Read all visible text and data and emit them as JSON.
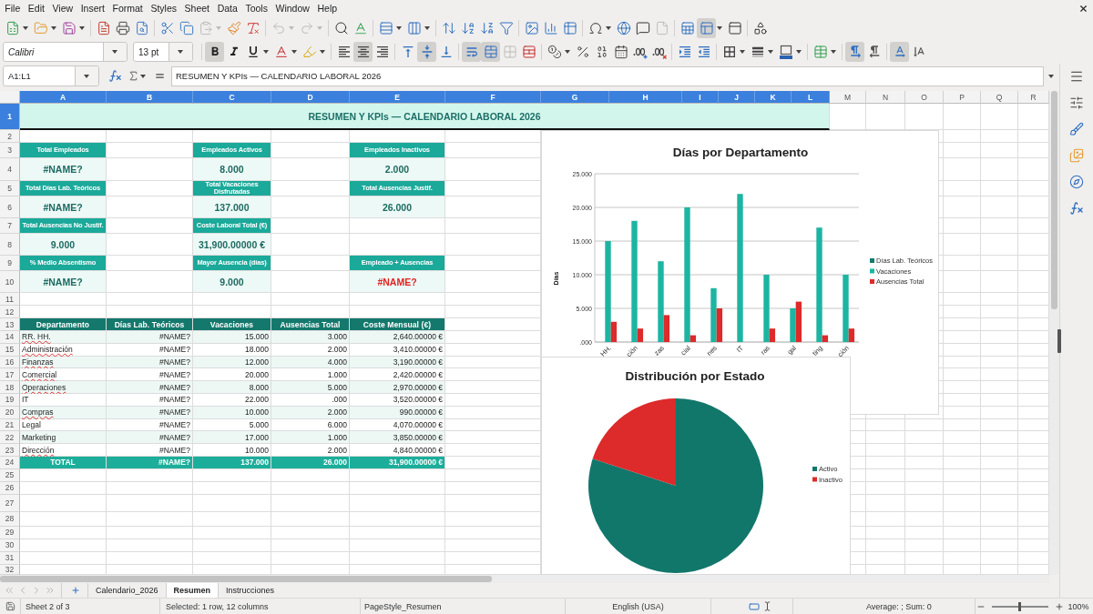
{
  "menu_bar": {
    "items": [
      "File",
      "Edit",
      "View",
      "Insert",
      "Format",
      "Styles",
      "Sheet",
      "Data",
      "Tools",
      "Window",
      "Help"
    ]
  },
  "standard_toolbar": [
    {
      "kind": "new",
      "pressed": false,
      "disabled": false
    },
    {
      "kind": "open",
      "pressed": false,
      "disabled": false
    },
    {
      "kind": "save",
      "pressed": false,
      "disabled": false
    },
    {
      "kind": "export_pdf",
      "pressed": false,
      "disabled": false
    },
    {
      "kind": "print",
      "pressed": false,
      "disabled": false
    },
    {
      "kind": "print_preview",
      "pressed": false,
      "disabled": false
    },
    {
      "kind": "cut",
      "pressed": false,
      "disabled": false
    },
    {
      "kind": "copy",
      "pressed": false,
      "disabled": false
    },
    {
      "kind": "paste",
      "pressed": false,
      "disabled": true
    },
    {
      "kind": "clone",
      "pressed": false,
      "disabled": false
    },
    {
      "kind": "clear",
      "pressed": false,
      "disabled": false
    },
    {
      "kind": "undo",
      "pressed": false,
      "disabled": true
    },
    {
      "kind": "redo",
      "pressed": false,
      "disabled": true
    },
    {
      "kind": "find",
      "pressed": false,
      "disabled": false
    },
    {
      "kind": "spelling",
      "pressed": false,
      "disabled": false
    },
    {
      "kind": "row",
      "pressed": false,
      "disabled": false
    },
    {
      "kind": "column",
      "pressed": false,
      "disabled": false
    },
    {
      "kind": "sort",
      "pressed": false,
      "disabled": false
    },
    {
      "kind": "sort_asc",
      "pressed": false,
      "disabled": false
    },
    {
      "kind": "sort_desc",
      "pressed": false,
      "disabled": false
    },
    {
      "kind": "autofilter",
      "pressed": false,
      "disabled": false
    },
    {
      "kind": "image",
      "pressed": false,
      "disabled": false
    },
    {
      "kind": "chart",
      "pressed": false,
      "disabled": false
    },
    {
      "kind": "pivot",
      "pressed": false,
      "disabled": false
    },
    {
      "kind": "special_char",
      "pressed": false,
      "disabled": false
    },
    {
      "kind": "hyperlink",
      "pressed": false,
      "disabled": false
    },
    {
      "kind": "comment",
      "pressed": false,
      "disabled": false
    },
    {
      "kind": "header_footer",
      "pressed": false,
      "disabled": true
    },
    {
      "kind": "print_area",
      "pressed": false,
      "disabled": false
    },
    {
      "kind": "freeze",
      "pressed": true,
      "disabled": false
    },
    {
      "kind": "split",
      "pressed": false,
      "disabled": false
    },
    {
      "kind": "draw",
      "pressed": false,
      "disabled": false
    }
  ],
  "formatting_toolbar": {
    "font_name": "Calibri",
    "font_size": "13 pt",
    "buttons": [
      {
        "kind": "bold",
        "pressed": true,
        "disabled": false
      },
      {
        "kind": "italic",
        "pressed": false,
        "disabled": false
      },
      {
        "kind": "underline",
        "pressed": false,
        "disabled": false
      },
      {
        "kind": "font_color",
        "pressed": false,
        "disabled": false
      },
      {
        "kind": "highlight",
        "pressed": false,
        "disabled": false
      },
      {
        "kind": "align_left",
        "pressed": false,
        "disabled": false
      },
      {
        "kind": "align_center",
        "pressed": true,
        "disabled": false
      },
      {
        "kind": "align_right",
        "pressed": false,
        "disabled": false
      },
      {
        "kind": "align_top",
        "pressed": false,
        "disabled": false
      },
      {
        "kind": "align_middle",
        "pressed": true,
        "disabled": false
      },
      {
        "kind": "align_bottom",
        "pressed": false,
        "disabled": false
      },
      {
        "kind": "wrap",
        "pressed": true,
        "disabled": false
      },
      {
        "kind": "merge_center",
        "pressed": true,
        "disabled": false
      },
      {
        "kind": "merge",
        "pressed": false,
        "disabled": true
      },
      {
        "kind": "unmerge",
        "pressed": false,
        "disabled": false
      },
      {
        "kind": "number_format",
        "pressed": false,
        "disabled": false
      },
      {
        "kind": "percent",
        "pressed": false,
        "disabled": false
      },
      {
        "kind": "standard_format",
        "pressed": false,
        "disabled": false
      },
      {
        "kind": "date_format",
        "pressed": false,
        "disabled": false
      },
      {
        "kind": "add_decimal",
        "pressed": false,
        "disabled": false
      },
      {
        "kind": "delete_decimal",
        "pressed": false,
        "disabled": false
      },
      {
        "kind": "indent",
        "pressed": false,
        "disabled": false
      },
      {
        "kind": "outdent",
        "pressed": false,
        "disabled": false
      },
      {
        "kind": "borders",
        "pressed": false,
        "disabled": false
      },
      {
        "kind": "border_style",
        "pressed": false,
        "disabled": false
      },
      {
        "kind": "border_color",
        "pressed": false,
        "disabled": false
      },
      {
        "kind": "conditional",
        "pressed": false,
        "disabled": false
      },
      {
        "kind": "ltr",
        "pressed": true,
        "disabled": false
      },
      {
        "kind": "rtl",
        "pressed": false,
        "disabled": false
      },
      {
        "kind": "text_horizontal",
        "pressed": true,
        "disabled": false
      },
      {
        "kind": "text_vertical",
        "pressed": false,
        "disabled": false
      }
    ]
  },
  "formula_bar": {
    "name_box": "A1:L1",
    "content": "RESUMEN Y KPIs — CALENDARIO LABORAL 2026"
  },
  "sheet": {
    "column_headers": [
      {
        "label": "A",
        "selected": true
      },
      {
        "label": "B",
        "selected": true
      },
      {
        "label": "C",
        "selected": true
      },
      {
        "label": "D",
        "selected": true
      },
      {
        "label": "E",
        "selected": true
      },
      {
        "label": "F",
        "selected": true
      },
      {
        "label": "G",
        "selected": true
      },
      {
        "label": "H",
        "selected": true
      },
      {
        "label": "I",
        "selected": true
      },
      {
        "label": "J",
        "selected": true
      },
      {
        "label": "K",
        "selected": true
      },
      {
        "label": "L",
        "selected": true
      },
      {
        "label": "M",
        "selected": false
      },
      {
        "label": "N",
        "selected": false
      },
      {
        "label": "O",
        "selected": false
      },
      {
        "label": "P",
        "selected": false
      },
      {
        "label": "Q",
        "selected": false
      },
      {
        "label": "R",
        "selected": false
      }
    ],
    "row_headers": [
      {
        "label": "1",
        "selected": true
      },
      {
        "label": "2",
        "selected": false
      },
      {
        "label": "3",
        "selected": false
      },
      {
        "label": "4",
        "selected": false
      },
      {
        "label": "5",
        "selected": false
      },
      {
        "label": "6",
        "selected": false
      },
      {
        "label": "7",
        "selected": false
      },
      {
        "label": "8",
        "selected": false
      },
      {
        "label": "9",
        "selected": false
      },
      {
        "label": "10",
        "selected": false
      },
      {
        "label": "11",
        "selected": false
      },
      {
        "label": "12",
        "selected": false
      },
      {
        "label": "13",
        "selected": false
      },
      {
        "label": "14",
        "selected": false
      },
      {
        "label": "15",
        "selected": false
      },
      {
        "label": "16",
        "selected": false
      },
      {
        "label": "17",
        "selected": false
      },
      {
        "label": "18",
        "selected": false
      },
      {
        "label": "19",
        "selected": false
      },
      {
        "label": "20",
        "selected": false
      },
      {
        "label": "21",
        "selected": false
      },
      {
        "label": "22",
        "selected": false
      },
      {
        "label": "23",
        "selected": false
      },
      {
        "label": "24",
        "selected": false
      },
      {
        "label": "25",
        "selected": false
      },
      {
        "label": "26",
        "selected": false
      },
      {
        "label": "27",
        "selected": false
      },
      {
        "label": "28",
        "selected": false
      },
      {
        "label": "29",
        "selected": false
      },
      {
        "label": "30",
        "selected": false
      },
      {
        "label": "31",
        "selected": false
      },
      {
        "label": "32",
        "selected": false
      }
    ],
    "title": "RESUMEN Y KPIs — CALENDARIO LABORAL 2026",
    "kpi_rows": [
      {
        "cards": [
          {
            "label": "Total Empleados",
            "value": "#NAME?",
            "flagged": false
          },
          {
            "label": "Empleados Activos",
            "value": "8.000",
            "flagged": false
          },
          {
            "label": "Empleados Inactivos",
            "value": "2.000",
            "flagged": false
          }
        ]
      },
      {
        "cards": [
          {
            "label": "Total Días Lab. Teóricos",
            "value": "#NAME?",
            "flagged": false
          },
          {
            "label": "Total Vacaciones Disfrutadas",
            "value": "137.000",
            "flagged": false
          },
          {
            "label": "Total Ausencias Justif.",
            "value": "26.000",
            "flagged": false
          }
        ]
      },
      {
        "cards": [
          {
            "label": "Total Ausencias No Justif.",
            "value": "9.000",
            "flagged": false
          },
          {
            "label": "Coste Laboral Total (€)",
            "value": "31,900.00000 €",
            "flagged": false
          }
        ]
      },
      {
        "cards": [
          {
            "label": "% Medio Absentismo",
            "value": "#NAME?",
            "flagged": false
          },
          {
            "label": "Mayor Ausencia (días)",
            "value": "9.000",
            "flagged": false
          },
          {
            "label": "Empleado + Ausencias",
            "value": "#NAME?",
            "flagged": true
          }
        ]
      }
    ],
    "table": {
      "columns": [
        "Departamento",
        "Días Lab. Teóricos",
        "Vacaciones",
        "Ausencias Total",
        "Coste Mensual (€)"
      ],
      "rows": [
        {
          "cells": [
            "RR. HH.",
            "#NAME?",
            "15.000",
            "3.000",
            "2,640.00000 €"
          ],
          "spelling_error": true
        },
        {
          "cells": [
            "Administración",
            "#NAME?",
            "18.000",
            "2.000",
            "3,410.00000 €"
          ],
          "spelling_error": true
        },
        {
          "cells": [
            "Finanzas",
            "#NAME?",
            "12.000",
            "4.000",
            "3,190.00000 €"
          ],
          "spelling_error": true
        },
        {
          "cells": [
            "Comercial",
            "#NAME?",
            "20.000",
            "1.000",
            "2,420.00000 €"
          ],
          "spelling_error": true
        },
        {
          "cells": [
            "Operaciones",
            "#NAME?",
            "8.000",
            "5.000",
            "2,970.00000 €"
          ],
          "spelling_error": true
        },
        {
          "cells": [
            "IT",
            "#NAME?",
            "22.000",
            ".000",
            "3,520.00000 €"
          ],
          "spelling_error": false
        },
        {
          "cells": [
            "Compras",
            "#NAME?",
            "10.000",
            "2.000",
            "990.00000 €"
          ],
          "spelling_error": true
        },
        {
          "cells": [
            "Legal",
            "#NAME?",
            "5.000",
            "6.000",
            "4,070.00000 €"
          ],
          "spelling_error": false
        },
        {
          "cells": [
            "Marketing",
            "#NAME?",
            "17.000",
            "1.000",
            "3,850.00000 €"
          ],
          "spelling_error": false
        },
        {
          "cells": [
            "Dirección",
            "#NAME?",
            "10.000",
            "2.000",
            "4,840.00000 €"
          ],
          "spelling_error": true
        }
      ],
      "total": [
        "TOTAL",
        "#NAME?",
        "137.000",
        "26.000",
        "31,900.00000 €"
      ]
    }
  },
  "bar_chart": {
    "chart_data": {
      "type": "bar",
      "title": "Días por Departamento",
      "ylabel": "Días",
      "categories": [
        "HH.",
        "ción",
        "zas",
        "cial",
        "nes",
        "IT",
        "ras",
        "gal",
        "ting",
        "ción"
      ],
      "series": [
        {
          "name": "Días Lab. Teóricos",
          "color": "#15796d",
          "values": [
            null,
            null,
            null,
            null,
            null,
            null,
            null,
            null,
            null,
            null
          ]
        },
        {
          "name": "Vacaciones",
          "color": "#1cb5a2",
          "values": [
            15,
            18,
            12,
            20,
            8,
            22,
            10,
            5,
            17,
            10
          ]
        },
        {
          "name": "Ausencias Total",
          "color": "#dd2a2a",
          "values": [
            3,
            2,
            4,
            1,
            5,
            0,
            2,
            6,
            1,
            2
          ]
        }
      ],
      "ylim": [
        0,
        25
      ],
      "yticks": [
        {
          "value": 0,
          "label": ".000"
        },
        {
          "value": 5,
          "label": "5.000"
        },
        {
          "value": 10,
          "label": "10.000"
        },
        {
          "value": 15,
          "label": "15.000"
        },
        {
          "value": 20,
          "label": "20.000"
        },
        {
          "value": 25,
          "label": "25.000"
        }
      ],
      "grid": true,
      "legend": "right"
    }
  },
  "pie_chart": {
    "chart_data": {
      "type": "pie",
      "title": "Distribución por Estado",
      "categories": [
        "Activo",
        "Inactivo"
      ],
      "values": [
        80,
        20
      ],
      "colors": [
        "#12776b",
        "#dd2a2a"
      ],
      "legend": "right"
    }
  },
  "sheet_navigation": [
    {
      "kind": "first",
      "disabled": true
    },
    {
      "kind": "previous",
      "disabled": true
    },
    {
      "kind": "next",
      "disabled": true
    },
    {
      "kind": "last",
      "disabled": true
    }
  ],
  "sheet_tabs": [
    {
      "label": "Calendario_2026",
      "selected": false
    },
    {
      "label": "Resumen",
      "selected": true
    },
    {
      "label": "Instrucciones",
      "selected": false
    }
  ],
  "status_bar": {
    "sheet": "Sheet 2 of 3",
    "selection": "Selected: 1 row, 12 columns",
    "page_style": "PageStyle_Resumen",
    "language": "English (USA)",
    "summary": "Average: ; Sum: 0",
    "zoom": {
      "level": 0.5,
      "percent": "100%"
    }
  }
}
